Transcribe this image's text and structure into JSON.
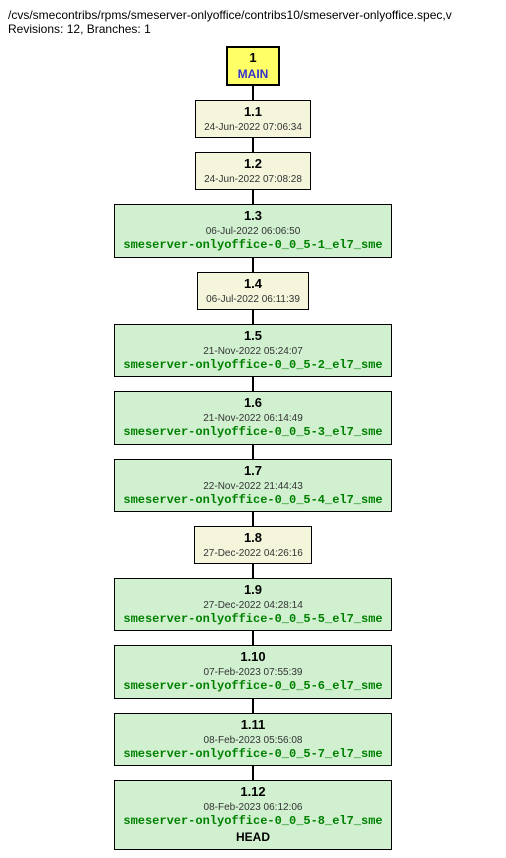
{
  "header": {
    "path": "/cvs/smecontribs/rpms/smeserver-onlyoffice/contribs10/smeserver-onlyoffice.spec,v",
    "revisions_label": "Revisions:",
    "revisions_count": "12",
    "branches_label": "Branches:",
    "branches_count": "1"
  },
  "main": {
    "number": "1",
    "label": "MAIN"
  },
  "nodes": [
    {
      "rev": "1.1",
      "date": "24-Jun-2022 07:06:34",
      "tag": null,
      "head": null,
      "bg": "cream"
    },
    {
      "rev": "1.2",
      "date": "24-Jun-2022 07:08:28",
      "tag": null,
      "head": null,
      "bg": "cream"
    },
    {
      "rev": "1.3",
      "date": "06-Jul-2022 06:06:50",
      "tag": "smeserver-onlyoffice-0_0_5-1_el7_sme",
      "head": null,
      "bg": "green"
    },
    {
      "rev": "1.4",
      "date": "06-Jul-2022 06:11:39",
      "tag": null,
      "head": null,
      "bg": "cream"
    },
    {
      "rev": "1.5",
      "date": "21-Nov-2022 05:24:07",
      "tag": "smeserver-onlyoffice-0_0_5-2_el7_sme",
      "head": null,
      "bg": "green"
    },
    {
      "rev": "1.6",
      "date": "21-Nov-2022 06:14:49",
      "tag": "smeserver-onlyoffice-0_0_5-3_el7_sme",
      "head": null,
      "bg": "green"
    },
    {
      "rev": "1.7",
      "date": "22-Nov-2022 21:44:43",
      "tag": "smeserver-onlyoffice-0_0_5-4_el7_sme",
      "head": null,
      "bg": "green"
    },
    {
      "rev": "1.8",
      "date": "27-Dec-2022 04:26:16",
      "tag": null,
      "head": null,
      "bg": "cream"
    },
    {
      "rev": "1.9",
      "date": "27-Dec-2022 04:28:14",
      "tag": "smeserver-onlyoffice-0_0_5-5_el7_sme",
      "head": null,
      "bg": "green"
    },
    {
      "rev": "1.10",
      "date": "07-Feb-2023 07:55:39",
      "tag": "smeserver-onlyoffice-0_0_5-6_el7_sme",
      "head": null,
      "bg": "green"
    },
    {
      "rev": "1.11",
      "date": "08-Feb-2023 05:56:08",
      "tag": "smeserver-onlyoffice-0_0_5-7_el7_sme",
      "head": null,
      "bg": "green"
    },
    {
      "rev": "1.12",
      "date": "08-Feb-2023 06:12:06",
      "tag": "smeserver-onlyoffice-0_0_5-8_el7_sme",
      "head": "HEAD",
      "bg": "green"
    }
  ]
}
